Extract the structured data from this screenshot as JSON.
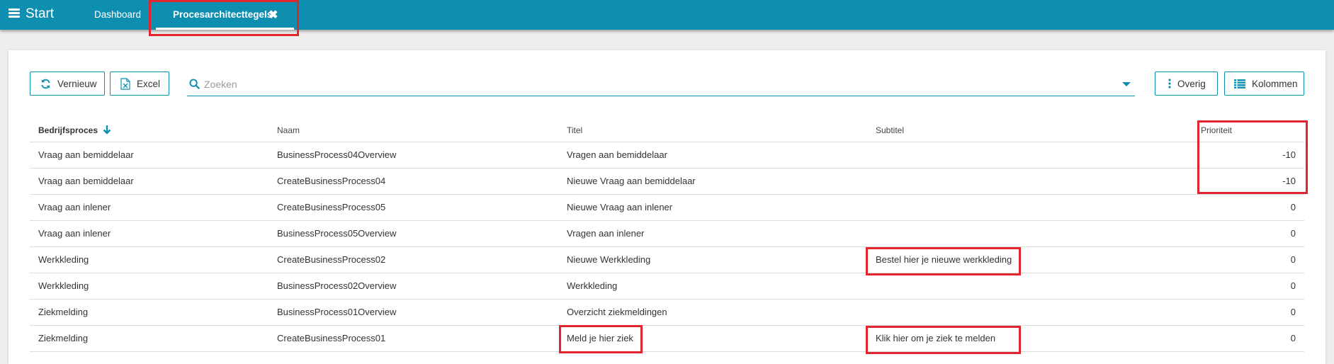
{
  "app": {
    "title": "Start"
  },
  "tabs": [
    {
      "label": "Dashboard"
    },
    {
      "label": "Procesarchitecttegels"
    }
  ],
  "toolbar": {
    "refresh_label": "Vernieuw",
    "excel_label": "Excel",
    "overig_label": "Overig",
    "columns_label": "Kolommen"
  },
  "search": {
    "placeholder": "Zoeken",
    "value": ""
  },
  "table": {
    "columns": [
      "Bedrijfsproces",
      "Naam",
      "Titel",
      "Subtitel",
      "Prioriteit"
    ],
    "sort_column": "Bedrijfsproces",
    "rows": [
      {
        "bedrijfsproces": "Vraag aan bemiddelaar",
        "naam": "BusinessProcess04Overview",
        "titel": "Vragen aan bemiddelaar",
        "subtitel": "",
        "prioriteit": "-10"
      },
      {
        "bedrijfsproces": "Vraag aan bemiddelaar",
        "naam": "CreateBusinessProcess04",
        "titel": "Nieuwe Vraag aan bemiddelaar",
        "subtitel": "",
        "prioriteit": "-10"
      },
      {
        "bedrijfsproces": "Vraag aan inlener",
        "naam": "CreateBusinessProcess05",
        "titel": "Nieuwe Vraag aan inlener",
        "subtitel": "",
        "prioriteit": "0"
      },
      {
        "bedrijfsproces": "Vraag aan inlener",
        "naam": "BusinessProcess05Overview",
        "titel": "Vragen aan inlener",
        "subtitel": "",
        "prioriteit": "0"
      },
      {
        "bedrijfsproces": "Werkkleding",
        "naam": "CreateBusinessProcess02",
        "titel": "Nieuwe Werkkleding",
        "subtitel": "Bestel hier je nieuwe werkkleding",
        "prioriteit": "0"
      },
      {
        "bedrijfsproces": "Werkkleding",
        "naam": "BusinessProcess02Overview",
        "titel": "Werkkleding",
        "subtitel": "",
        "prioriteit": "0"
      },
      {
        "bedrijfsproces": "Ziekmelding",
        "naam": "BusinessProcess01Overview",
        "titel": "Overzicht ziekmeldingen",
        "subtitel": "",
        "prioriteit": "0"
      },
      {
        "bedrijfsproces": "Ziekmelding",
        "naam": "CreateBusinessProcess01",
        "titel": "Meld je hier ziek",
        "subtitel": "Klik hier om je ziek te melden",
        "prioriteit": "0"
      }
    ]
  },
  "colors": {
    "accent": "#0f8faf",
    "highlight": "#e0252f"
  },
  "icons": [
    "menu-icon",
    "close-icon",
    "refresh-icon",
    "excel-icon",
    "search-icon",
    "chevron-down-icon",
    "kebab-icon",
    "list-icon",
    "sort-down-icon"
  ]
}
